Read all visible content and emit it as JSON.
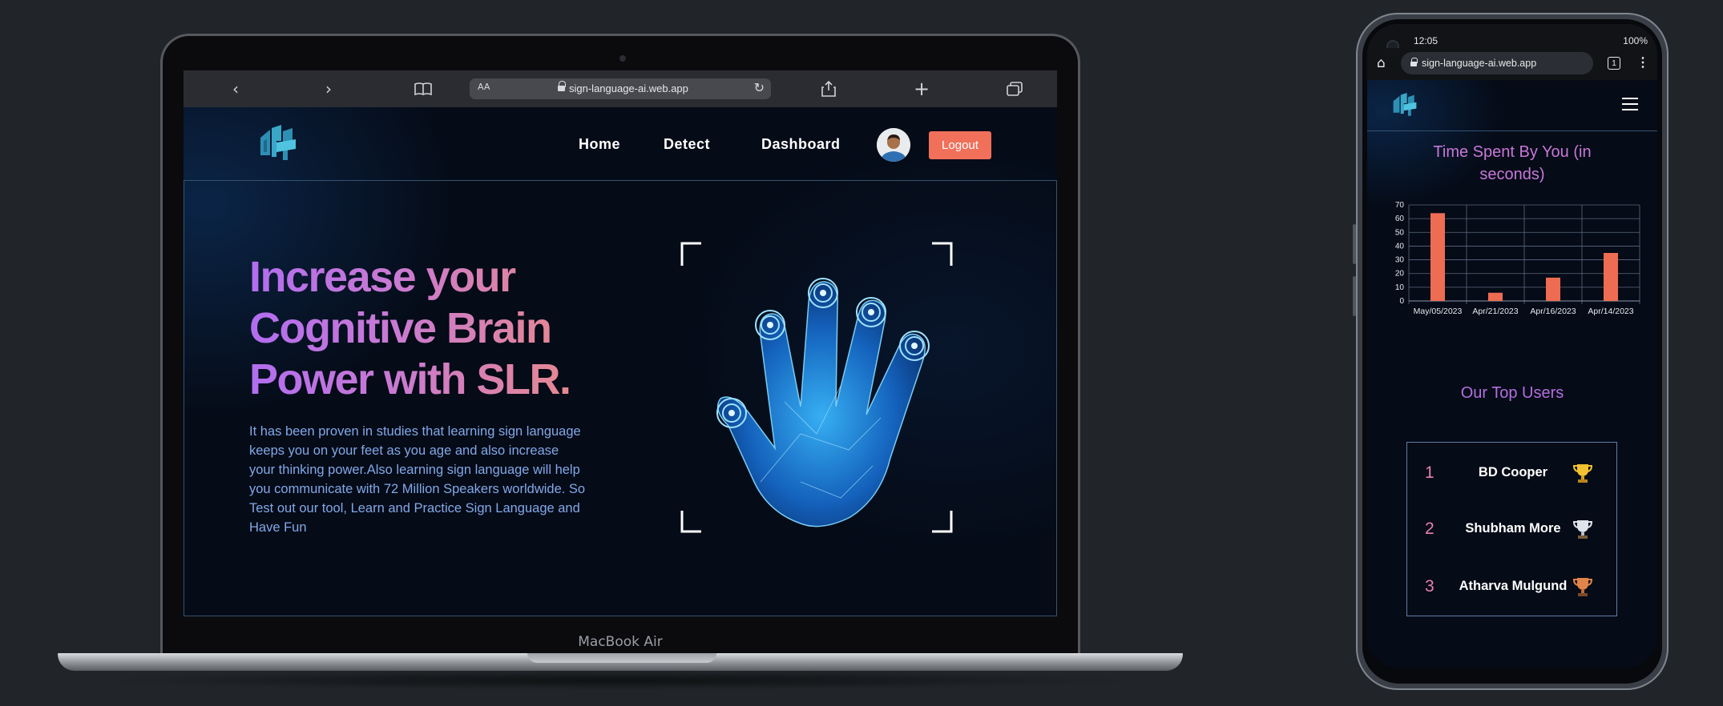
{
  "laptop": {
    "bezel_label": "MacBook Air",
    "browser": {
      "text_size_label": "AA",
      "url": "sign-language-ai.web.app",
      "icons": [
        "back-icon",
        "forward-icon",
        "bookmarks-icon",
        "reload-icon",
        "share-icon",
        "new-tab-icon",
        "tabs-icon"
      ]
    },
    "site": {
      "nav": [
        {
          "label": "Home"
        },
        {
          "label": "Detect"
        },
        {
          "label": "Dashboard"
        }
      ],
      "logout_label": "Logout",
      "hero": {
        "title": "Increase your Cognitive Brain Power with SLR.",
        "body": "It has been proven in studies that learning sign language keeps you on your feet as you age and also increase your thinking power.Also learning sign language will help you communicate with 72 Million Speakers worldwide. So Test out our tool, Learn and Practice Sign Language and Have Fun"
      }
    }
  },
  "phone": {
    "status": {
      "time": "12:05",
      "battery": "100%"
    },
    "browser": {
      "url": "sign-language-ai.web.app",
      "tab_count": "1"
    },
    "dashboard": {
      "chart_title": "Time Spent By You (in seconds)",
      "top_users_title": "Our Top Users",
      "top_users": [
        {
          "rank": "1",
          "name": "BD Cooper",
          "trophy": "gold-trophy-icon"
        },
        {
          "rank": "2",
          "name": "Shubham More",
          "trophy": "silver-trophy-icon"
        },
        {
          "rank": "3",
          "name": "Atharva Mulgund",
          "trophy": "bronze-trophy-icon"
        }
      ]
    }
  },
  "colors": {
    "accent_button": "#f0705a",
    "bar": "#ee6c52",
    "title_purple": "#b26df0",
    "title_pink": "#c978d8",
    "body_blue": "#83a8e8",
    "background": "#050b17"
  },
  "chart_data": {
    "type": "bar",
    "title": "Time Spent By You (in seconds)",
    "categories": [
      "May/05/2023",
      "Apr/21/2023",
      "Apr/16/2023",
      "Apr/14/2023"
    ],
    "values": [
      64,
      6,
      17,
      35
    ],
    "ylim": [
      0,
      70
    ],
    "yticks": [
      0,
      10,
      20,
      30,
      40,
      50,
      60,
      70
    ],
    "grid": true,
    "xlabel": "",
    "ylabel": ""
  }
}
